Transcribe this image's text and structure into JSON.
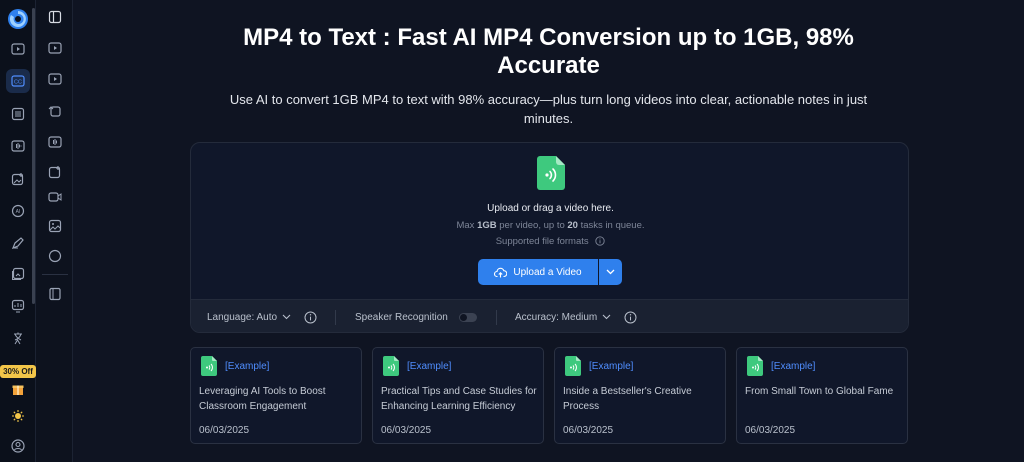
{
  "header": {
    "title": "MP4 to Text : Fast AI MP4 Conversion up to 1GB, 98% Accurate",
    "subtitle": "Use AI to convert 1GB MP4 to text with 98% accuracy—plus turn long videos into clear, actionable notes in just minutes."
  },
  "sidebar": {
    "promo": "30% Off",
    "items": [
      "logo-icon",
      "play-icon",
      "captions-icon",
      "list-icon",
      "waveform-icon",
      "image-edit-icon",
      "ai-icon",
      "pen-icon",
      "gallery-icon",
      "chart-icon",
      "translate-icon",
      "gift-icon",
      "sun-icon",
      "user-icon"
    ]
  },
  "subbar": {
    "items": [
      "sidebar-toggle-icon",
      "play-icon",
      "play-icon",
      "image-swap-icon",
      "waveform-icon",
      "image-add-icon",
      "video-icon",
      "image-icon",
      "circle-icon",
      "book-icon"
    ]
  },
  "upload": {
    "title": "Upload or drag a video here.",
    "limit_prefix": "Max ",
    "limit_size": "1GB",
    "limit_mid": " per video, up to ",
    "limit_count": "20",
    "limit_suffix": " tasks in queue.",
    "formats": "Supported file formats",
    "button": "Upload a Video"
  },
  "options": {
    "language": "Language: Auto",
    "speaker": "Speaker Recognition",
    "speaker_enabled": false,
    "accuracy": "Accuracy: Medium"
  },
  "examples": [
    {
      "tag": "[Example]",
      "title": "Leveraging AI Tools to Boost Classroom Engagement",
      "date": "06/03/2025"
    },
    {
      "tag": "[Example]",
      "title": "Practical Tips and Case Studies for Enhancing Learning Efficiency",
      "date": "06/03/2025"
    },
    {
      "tag": "[Example]",
      "title": "Inside a Bestseller's Creative Process",
      "date": "06/03/2025"
    },
    {
      "tag": "[Example]",
      "title": "From Small Town to Global Fame",
      "date": "06/03/2025"
    }
  ],
  "colors": {
    "accent": "#2f80ed",
    "file_icon": "#3ec97e",
    "promo": "#f3c649",
    "background": "#0f1422"
  }
}
